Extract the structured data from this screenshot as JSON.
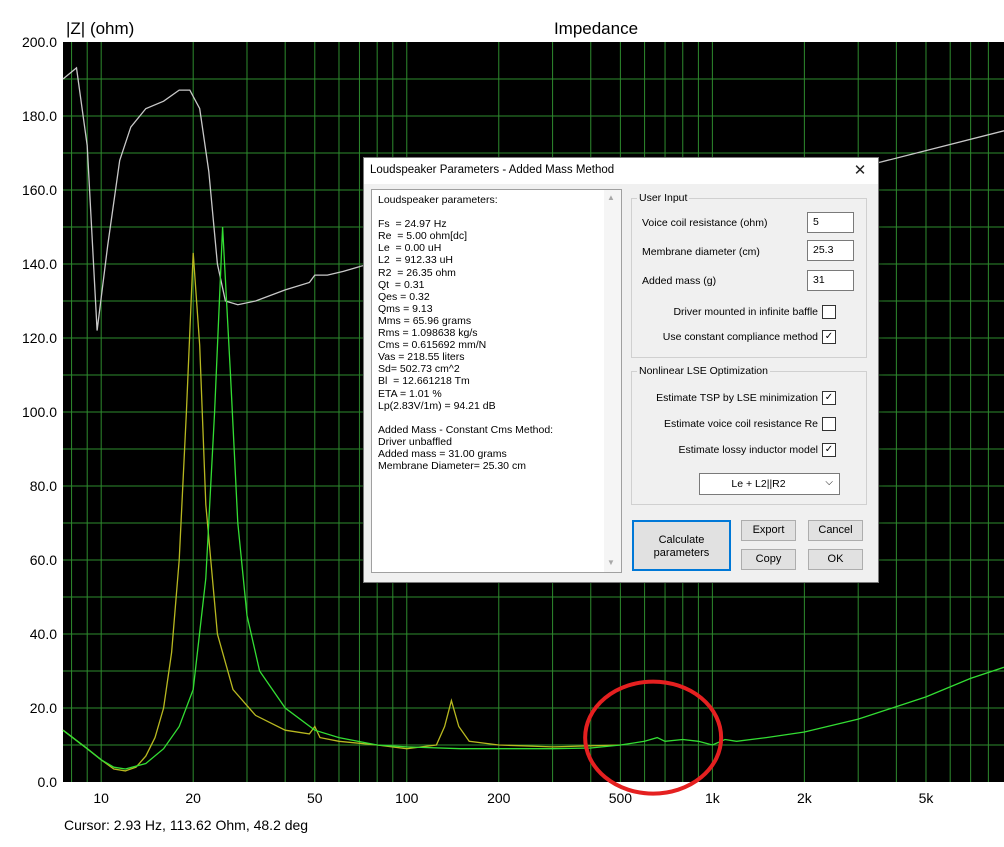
{
  "chart_data": {
    "type": "line",
    "title": "Impedance",
    "ylabel": "|Z| (ohm)",
    "xscale": "log",
    "xlim": [
      7.5,
      9000
    ],
    "ylim": [
      0,
      200
    ],
    "yticks": [
      "0.0",
      "20.0",
      "40.0",
      "60.0",
      "80.0",
      "100.0",
      "120.0",
      "140.0",
      "160.0",
      "180.0",
      "200.0"
    ],
    "xticks": [
      {
        "value": 10,
        "label": "10"
      },
      {
        "value": 20,
        "label": "20"
      },
      {
        "value": 50,
        "label": "50"
      },
      {
        "value": 100,
        "label": "100"
      },
      {
        "value": 200,
        "label": "200"
      },
      {
        "value": 500,
        "label": "500"
      },
      {
        "value": 1000,
        "label": "1k"
      },
      {
        "value": 2000,
        "label": "2k"
      },
      {
        "value": 5000,
        "label": "5k"
      }
    ],
    "grid": true,
    "colors": {
      "background": "#000000",
      "grid": "#2e8b2e",
      "label_text": "#000000",
      "annotation_circle": "#e52020"
    },
    "series": [
      {
        "color": "#c8c8c8",
        "points": [
          [
            7.5,
            190
          ],
          [
            8.3,
            193
          ],
          [
            9,
            172
          ],
          [
            9.7,
            122
          ],
          [
            10.5,
            145
          ],
          [
            11.5,
            168
          ],
          [
            12.5,
            177
          ],
          [
            14,
            182
          ],
          [
            16,
            184
          ],
          [
            18,
            187
          ],
          [
            19.5,
            187
          ],
          [
            21,
            182
          ],
          [
            22.5,
            165
          ],
          [
            24,
            140
          ],
          [
            25.5,
            130
          ],
          [
            28,
            129
          ],
          [
            32,
            130
          ],
          [
            40,
            133
          ],
          [
            48,
            135
          ],
          [
            50,
            137
          ],
          [
            55,
            137
          ],
          [
            62,
            138
          ],
          [
            75,
            140
          ],
          [
            90,
            143
          ],
          [
            100,
            145
          ],
          [
            120,
            149
          ],
          [
            200,
            155
          ],
          [
            400,
            158
          ],
          [
            800,
            161
          ],
          [
            3000,
            166
          ],
          [
            9000,
            176
          ]
        ]
      },
      {
        "color": "#b8b820",
        "points": [
          [
            7.5,
            14
          ],
          [
            9,
            9
          ],
          [
            10,
            6
          ],
          [
            11,
            3.5
          ],
          [
            12,
            3
          ],
          [
            13,
            4
          ],
          [
            14,
            7
          ],
          [
            15,
            12
          ],
          [
            16,
            20
          ],
          [
            17,
            35
          ],
          [
            18,
            60
          ],
          [
            19,
            100
          ],
          [
            20,
            143
          ],
          [
            21,
            118
          ],
          [
            22,
            75
          ],
          [
            24,
            40
          ],
          [
            27,
            25
          ],
          [
            32,
            18
          ],
          [
            40,
            14
          ],
          [
            48,
            13
          ],
          [
            50,
            15
          ],
          [
            52,
            12
          ],
          [
            60,
            11
          ],
          [
            80,
            10
          ],
          [
            100,
            9
          ],
          [
            125,
            10
          ],
          [
            133,
            15
          ],
          [
            140,
            22
          ],
          [
            148,
            15
          ],
          [
            160,
            11
          ],
          [
            200,
            10
          ],
          [
            300,
            9.5
          ],
          [
            500,
            10
          ]
        ]
      },
      {
        "color": "#33dd33",
        "points": [
          [
            7.5,
            14
          ],
          [
            9,
            9
          ],
          [
            10,
            6
          ],
          [
            11,
            4
          ],
          [
            12,
            3.5
          ],
          [
            14,
            5
          ],
          [
            16,
            9
          ],
          [
            18,
            15
          ],
          [
            20,
            25
          ],
          [
            22,
            55
          ],
          [
            23.5,
            100
          ],
          [
            24.97,
            150
          ],
          [
            26.5,
            110
          ],
          [
            28,
            70
          ],
          [
            30,
            45
          ],
          [
            33,
            30
          ],
          [
            40,
            20
          ],
          [
            50,
            14
          ],
          [
            60,
            12
          ],
          [
            80,
            10
          ],
          [
            100,
            9.5
          ],
          [
            150,
            9
          ],
          [
            200,
            9
          ],
          [
            300,
            9
          ],
          [
            400,
            9.2
          ],
          [
            500,
            10
          ],
          [
            600,
            11
          ],
          [
            660,
            12
          ],
          [
            700,
            11
          ],
          [
            800,
            11.5
          ],
          [
            900,
            11
          ],
          [
            1000,
            10
          ],
          [
            1100,
            11.5
          ],
          [
            1200,
            11
          ],
          [
            1500,
            12
          ],
          [
            2000,
            13.5
          ],
          [
            3000,
            17
          ],
          [
            5000,
            23
          ],
          [
            7000,
            28
          ],
          [
            9000,
            31
          ]
        ]
      }
    ],
    "cursor": "Cursor: 2.93 Hz, 113.62 Ohm, 48.2 deg",
    "annotation_circle": {
      "x": 640,
      "y": 12
    }
  },
  "dialog": {
    "title": "Loudspeaker Parameters - Added Mass Method",
    "close_symbol": "✕",
    "params_lines": [
      "Loudspeaker parameters:",
      "",
      "Fs  = 24.97 Hz",
      "Re  = 5.00 ohm[dc]",
      "Le  = 0.00 uH",
      "L2  = 912.33 uH",
      "R2  = 26.35 ohm",
      "Qt  = 0.31",
      "Qes = 0.32",
      "Qms = 9.13",
      "Mms = 65.96 grams",
      "Rms = 1.098638 kg/s",
      "Cms = 0.615692 mm/N",
      "Vas = 218.55 liters",
      "Sd= 502.73 cm^2",
      "Bl  = 12.661218 Tm",
      "ETA = 1.01 %",
      "Lp(2.83V/1m) = 94.21 dB",
      "",
      "Added Mass - Constant Cms Method:",
      "Driver unbaffled",
      "Added mass = 31.00 grams",
      "Membrane Diameter= 25.30 cm"
    ],
    "user_input": {
      "legend": "User Input",
      "voice_coil_label": "Voice coil resistance (ohm)",
      "voice_coil_value": "5",
      "membrane_label": "Membrane diameter (cm)",
      "membrane_value": "25.3",
      "added_mass_label": "Added mass (g)",
      "added_mass_value": "31",
      "infinite_baffle_label": "Driver mounted in infinite baffle",
      "infinite_baffle_checked": false,
      "constant_compliance_label": "Use constant compliance method",
      "constant_compliance_checked": true
    },
    "lse": {
      "legend": "Nonlinear LSE Optimization",
      "estimate_tsp_label": "Estimate TSP by LSE minimization",
      "estimate_tsp_checked": true,
      "estimate_re_label": "Estimate voice coil resistance Re",
      "estimate_re_checked": false,
      "estimate_lossy_label": "Estimate lossy inductor model",
      "estimate_lossy_checked": true,
      "model_selected": "Le + L2||R2"
    },
    "buttons": {
      "calculate": "Calculate parameters",
      "export": "Export",
      "cancel": "Cancel",
      "copy": "Copy",
      "ok": "OK"
    }
  }
}
